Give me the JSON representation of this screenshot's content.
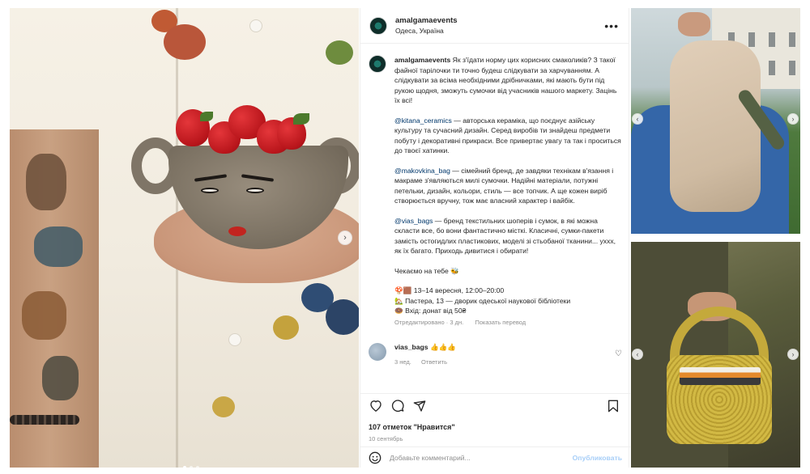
{
  "post": {
    "username": "amalgamaevents",
    "location": "Одеса, Україна",
    "more_label": "•••"
  },
  "caption": {
    "username": "amalgamaevents",
    "intro": "Як з'їдати норму цих корисних смаколиків? З такої файної тарілочки ти точно будеш слідкувати за харчуванням. А слідкувати за всіма необхідними дрібничками, які мають бути під рукою щодня, зможуть сумочки від учасників нашого маркету. Зацінь їх всі!",
    "p1_mention": "@kitana_ceramics",
    "p1_text": " — авторська кераміка, що поєднує азійську культуру та сучасний дизайн. Серед виробів ти знайдеш предмети побуту і декоративні прикраси. Все привертає увагу та так і проситься до твоєї хатинки.",
    "p2_mention": "@makovkina_bag",
    "p2_text": " — сімейний бренд, де завдяки технікам в'язання і макраме з'являються милі сумочки. Надійні матеріали, потужні петельки, дизайн, кольори, стиль — все топчик. А ще кожен виріб створюється вручну, тож має власний характер і вайбік.",
    "p3_mention": "@vias_bags",
    "p3_text": " — бренд текстильних шоперів і сумок, в які можна скласти все, бо вони фантастично місткі. Класичні, сумки-пакети замість остогидлих пластикових, моделі зі стьобаної тканини... уххх, як їх багато. Приходь дивитися і обирати!",
    "waiting": "Чекаємо на тебе 🐝",
    "line_date": "🍄🟫 13–14 вересня, 12:00–20:00",
    "line_place": "🏡 Пастера, 13 — дворик одеської наукової бібліотеки",
    "line_entry": "🍩 Вхід: донат від 50₴",
    "edited": "Отредактировано · 3 дн.",
    "translate": "Показать перевод"
  },
  "comment": {
    "username": "vias_bags",
    "text": "👍👍👍",
    "time": "3 нед.",
    "reply": "Ответить"
  },
  "likes": "107 отметок \"Нравится\"",
  "date": "10 сентябрь",
  "add_comment": {
    "placeholder": "Добавьте комментарий...",
    "publish": "Опубликовать"
  },
  "carousel": {
    "dots_total": 3,
    "active_index": 0
  },
  "icons": [
    "heart-icon",
    "comment-icon",
    "share-icon",
    "bookmark-icon",
    "emoji-icon",
    "more-icon",
    "chevron-right-icon",
    "chevron-left-icon"
  ]
}
